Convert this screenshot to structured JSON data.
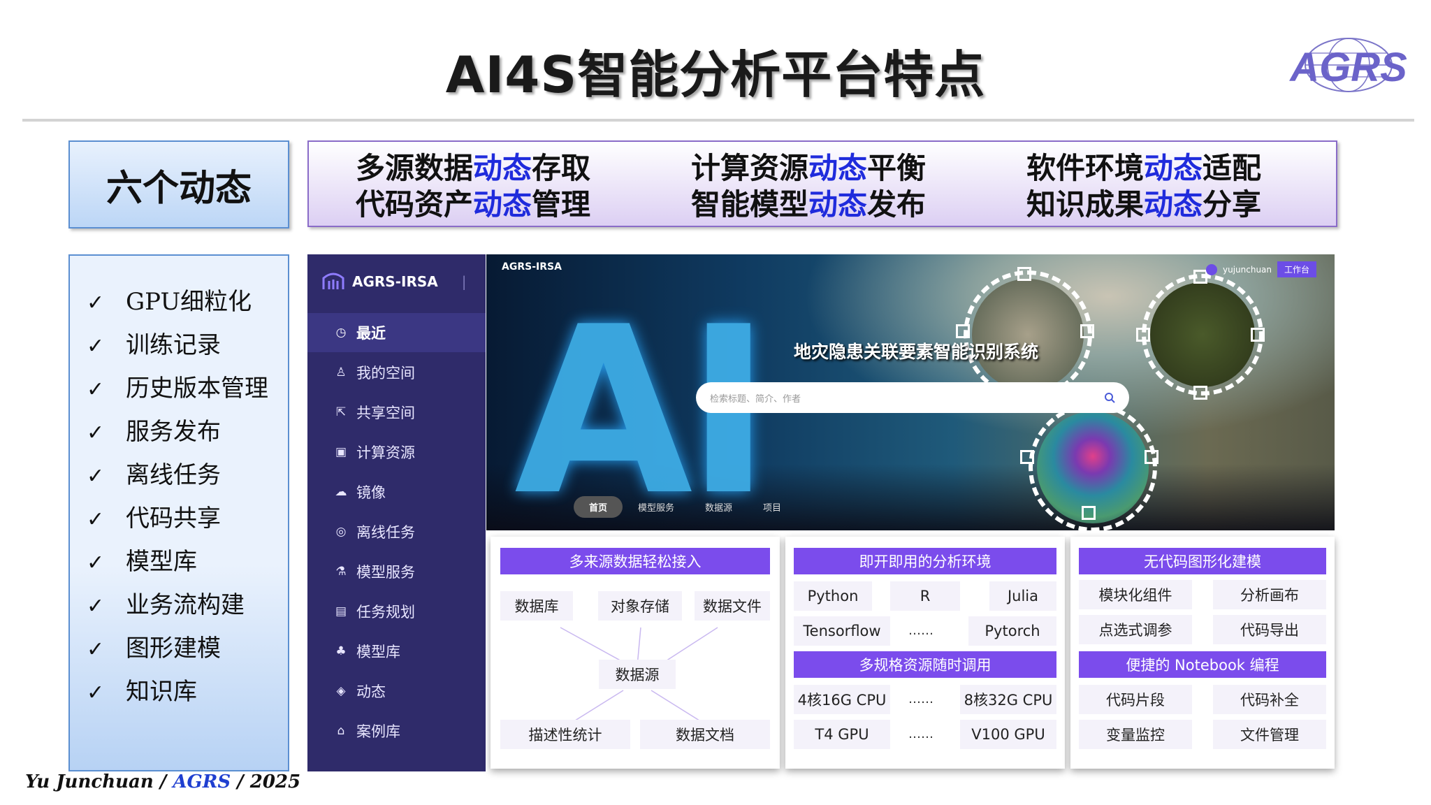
{
  "slide": {
    "title": "AI4S智能分析平台特点",
    "logo_text": "AGRS",
    "six_dynamics_label": "六个动态",
    "dynamics": [
      {
        "l1_pre": "多源数据",
        "l1_hl": "动态",
        "l1_post": "存取",
        "l2_pre": "代码资产",
        "l2_hl": "动态",
        "l2_post": "管理"
      },
      {
        "l1_pre": "计算资源",
        "l1_hl": "动态",
        "l1_post": "平衡",
        "l2_pre": "智能模型",
        "l2_hl": "动态",
        "l2_post": "发布"
      },
      {
        "l1_pre": "软件环境",
        "l1_hl": "动态",
        "l1_post": "适配",
        "l2_pre": "知识成果",
        "l2_hl": "动态",
        "l2_post": "分享"
      }
    ],
    "check_mark": "✓",
    "features": [
      "GPU细粒化",
      "训练记录",
      "历史版本管理",
      "服务发布",
      "离线任务",
      "代码共享",
      "模型库",
      "业务流构建",
      "图形建模",
      "知识库"
    ],
    "footer": {
      "author": "Yu Junchuan / ",
      "org": "AGRS",
      "year": " / 2025"
    },
    "accent_colors": {
      "highlight": "#1f2bdc",
      "sidebar": "#2f2b6a",
      "panel_header": "#7b4cec"
    }
  },
  "app": {
    "brand": "AGRS-IRSA",
    "sidebar": [
      {
        "icon": "clock-icon",
        "glyph": "◷",
        "label": "最近",
        "active": true
      },
      {
        "icon": "user-icon",
        "glyph": "♙",
        "label": "我的空间",
        "active": false
      },
      {
        "icon": "share-icon",
        "glyph": "⇱",
        "label": "共享空间",
        "active": false
      },
      {
        "icon": "compute-icon",
        "glyph": "▣",
        "label": "计算资源",
        "active": false
      },
      {
        "icon": "image-icon",
        "glyph": "☁",
        "label": "镜像",
        "active": false
      },
      {
        "icon": "offline-task-icon",
        "glyph": "◎",
        "label": "离线任务",
        "active": false
      },
      {
        "icon": "model-service-icon",
        "glyph": "⚗",
        "label": "模型服务",
        "active": false
      },
      {
        "icon": "task-plan-icon",
        "glyph": "▤",
        "label": "任务规划",
        "active": false
      },
      {
        "icon": "model-library-icon",
        "glyph": "♣",
        "label": "模型库",
        "active": false
      },
      {
        "icon": "activity-icon",
        "glyph": "◈",
        "label": "动态",
        "active": false
      },
      {
        "icon": "case-library-icon",
        "glyph": "⌂",
        "label": "案例库",
        "active": false
      }
    ],
    "hero": {
      "brand": "AGRS-IRSA",
      "big_text": "AI",
      "system_title": "地灾隐患关联要素智能识别系统",
      "search_placeholder": "检索标题、简介、作者",
      "user": "yujunchuan",
      "workbench": "工作台",
      "tabs": [
        "首页",
        "模型服务",
        "数据源",
        "项目"
      ]
    },
    "panels": {
      "data": {
        "title": "多来源数据轻松接入",
        "sources": [
          "数据库",
          "对象存储",
          "数据文件"
        ],
        "hub": "数据源",
        "outputs": [
          "描述性统计",
          "数据文档"
        ]
      },
      "env": {
        "title": "即开即用的分析环境",
        "row1": [
          "Python",
          "R",
          "Julia"
        ],
        "row2": [
          "Tensorflow",
          "……",
          "Pytorch"
        ],
        "title2": "多规格资源随时调用",
        "row3": [
          "4核16G CPU",
          "……",
          "8核32G CPU"
        ],
        "row4": [
          "T4 GPU",
          "……",
          "V100 GPU"
        ]
      },
      "nocode": {
        "title": "无代码图形化建模",
        "row1": [
          "模块化组件",
          "分析画布"
        ],
        "row2": [
          "点选式调参",
          "代码导出"
        ],
        "title2": "便捷的 Notebook 编程",
        "row3": [
          "代码片段",
          "代码补全"
        ],
        "row4": [
          "变量监控",
          "文件管理"
        ]
      }
    }
  }
}
